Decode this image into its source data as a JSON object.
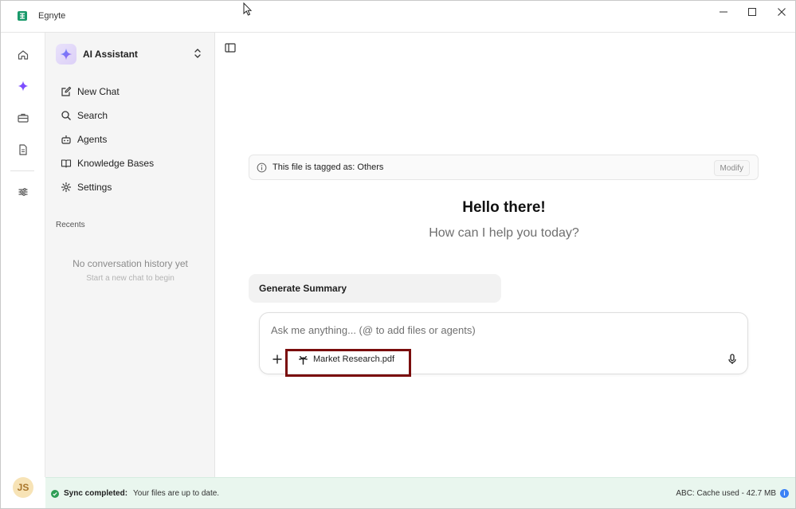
{
  "window": {
    "title": "Egnyte"
  },
  "rail": {
    "items": [
      {
        "name": "home-icon"
      },
      {
        "name": "ai-sparkle-icon"
      },
      {
        "name": "briefcase-icon"
      },
      {
        "name": "document-icon"
      },
      {
        "name": "sliders-icon"
      }
    ],
    "avatar_initials": "JS"
  },
  "sidebar": {
    "assistant_name": "AI Assistant",
    "nav": [
      {
        "label": "New Chat",
        "icon": "edit-icon"
      },
      {
        "label": "Search",
        "icon": "search-icon"
      },
      {
        "label": "Agents",
        "icon": "robot-icon"
      },
      {
        "label": "Knowledge Bases",
        "icon": "book-icon"
      },
      {
        "label": "Settings",
        "icon": "gear-icon"
      }
    ],
    "recents_label": "Recents",
    "empty_title": "No conversation history yet",
    "empty_subtitle": "Start a new chat to begin"
  },
  "main": {
    "tag_banner_text": "This file is tagged as: Others",
    "modify_label": "Modify",
    "hello": "Hello there!",
    "help_text": "How can I help you today?",
    "suggestion_label": "Generate Summary",
    "composer": {
      "placeholder": "Ask me anything... (@ to add files or agents)",
      "value": "",
      "file_chip": "Market Research.pdf"
    }
  },
  "status": {
    "sync_label": "Sync completed:",
    "sync_message": "Your files are up to date.",
    "cache_text": "ABC: Cache used - 42.7 MB"
  },
  "colors": {
    "accent": "#7c4dff",
    "status_bg": "#e9f6ee",
    "sync_green": "#2e9e55",
    "highlight": "#7a0d0d"
  }
}
